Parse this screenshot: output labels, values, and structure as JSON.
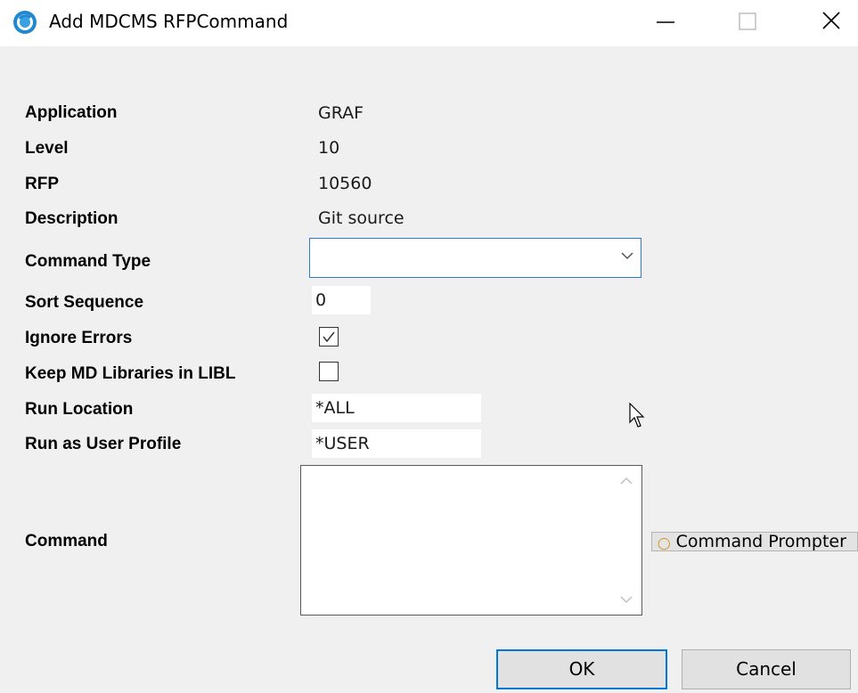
{
  "window": {
    "title": "Add MDCMS RFPCommand",
    "minimize_icon": "minimize-icon",
    "maximize_icon": "maximize-icon",
    "close_icon": "close-icon"
  },
  "form": {
    "application": {
      "label": "Application",
      "value": "GRAF"
    },
    "level": {
      "label": "Level",
      "value": "10"
    },
    "rfp": {
      "label": "RFP",
      "value": "10560"
    },
    "description": {
      "label": "Description",
      "value": "Git source"
    },
    "command_type": {
      "label": "Command Type",
      "value": ""
    },
    "sort_sequence": {
      "label": "Sort Sequence",
      "value": "0"
    },
    "ignore_errors": {
      "label": "Ignore Errors",
      "checked": true
    },
    "keep_md_libraries": {
      "label": "Keep MD Libraries in LIBL",
      "checked": false
    },
    "run_location": {
      "label": "Run Location",
      "value": "*ALL"
    },
    "run_as_user_profile": {
      "label": "Run as User Profile",
      "value": "*USER"
    },
    "command": {
      "label": "Command",
      "value": ""
    },
    "command_prompter": {
      "label": "Command Prompter"
    }
  },
  "buttons": {
    "ok": "OK",
    "cancel": "Cancel"
  },
  "colors": {
    "dialog_bg": "#f0f0f0",
    "focus_border": "#0078d7",
    "app_icon": "#1e88d0"
  }
}
